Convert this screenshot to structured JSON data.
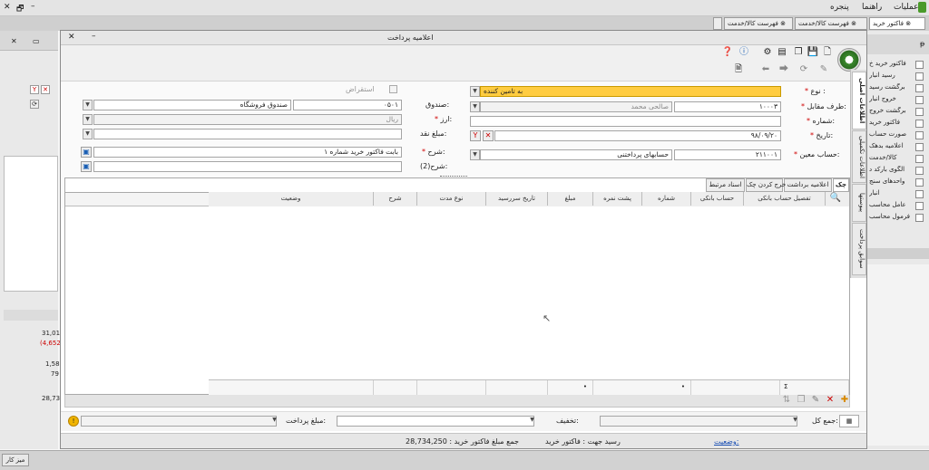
{
  "app": {
    "menu": [
      "عملیات",
      "راهنما",
      "پنجره"
    ],
    "close_x": "✕",
    "restore": "🗗",
    "minimize": "–"
  },
  "tabs": [
    {
      "label": "فاکتور خرید",
      "active": true
    },
    {
      "label": "فهرست کالا/خدمت"
    },
    {
      "label": "فهرست کالا/خدمت"
    },
    {
      "label": ""
    }
  ],
  "left_panel": {
    "values": [
      "31,01",
      "(4,652",
      "1,58",
      "79",
      "28,73"
    ]
  },
  "right_panel": {
    "items": [
      "فاکتور خرید خ",
      "رسید انبار",
      "برگشت رسید",
      "خروج انبار",
      "برگشت خروج",
      "فاکتور خرید",
      "صورت حساب",
      "اعلامیه بدهک",
      "کالا/خدمت",
      "الگوی بارکد د",
      "واحدهای سنج",
      "انبار",
      "عامل محاسب",
      "فرمول محاسب"
    ]
  },
  "dialog": {
    "title": "اعلامیه پرداخت",
    "vtabs": [
      "اطلاعات اصلی",
      "اطلاعات تکمیلی",
      "پیوستها",
      "سوابق پرداخت"
    ],
    "form": {
      "type_label": "نوع :",
      "type_value": "به تامین کننده",
      "party_label": "طرف مقابل:",
      "party_code": "۱۰۰۰۳",
      "party_name": "صالحی محمد",
      "number_label": "شماره:",
      "number_value": "",
      "date_label": "تاریخ:",
      "date_value": "۹۸/۰۹/۲۰",
      "account_label": "حساب معین:",
      "account_code": "۲۱۱۰۰۱",
      "account_name": "حسابهای پرداختنی",
      "fund_label": "صندوق:",
      "fund_code": "۰۵۰۱",
      "fund_name": "صندوق فروشگاه",
      "currency_label": "ارز:",
      "currency_value": "ریال",
      "cash_label": "مبلغ نقد:",
      "cash_value": "",
      "desc_label": "شرح:",
      "desc_value": "بابت فاکتور خرید شماره ۱",
      "desc2_label": "شرح(2):",
      "desc2_value": "",
      "checkbox_label": "استقراض"
    },
    "subtabs": [
      "چک",
      "اعلامیه برداشت",
      "خرج کردن چک",
      "اسناد مرتبط"
    ],
    "columns": [
      "تفصیل حساب بانکی",
      "حساب بانکی",
      "شماره",
      "پشت نمره",
      "مبلغ",
      "تاریخ سررسید",
      "نوع مدت",
      "شرح",
      "وضعیت"
    ],
    "grid_footer": {
      "sum_symbol": "Σ",
      "values": [
        "•",
        "•"
      ]
    },
    "bottom": {
      "total_label": "جمع کل:",
      "discount_label": "تخفیف:",
      "pay_amount_label": "مبلغ پرداخت:"
    },
    "status": {
      "status_label": "وضعیت:",
      "receipt_text": "رسید جهت : فاکتور خرید",
      "total_text": "جمع مبلغ فاکتور خرید : 28,734,250"
    }
  },
  "status_bar": {
    "desk_label": "میز کار"
  },
  "colors": {
    "required": "#d00000",
    "type_field": "#ffcc40",
    "chrome": "#e6e6e6"
  }
}
